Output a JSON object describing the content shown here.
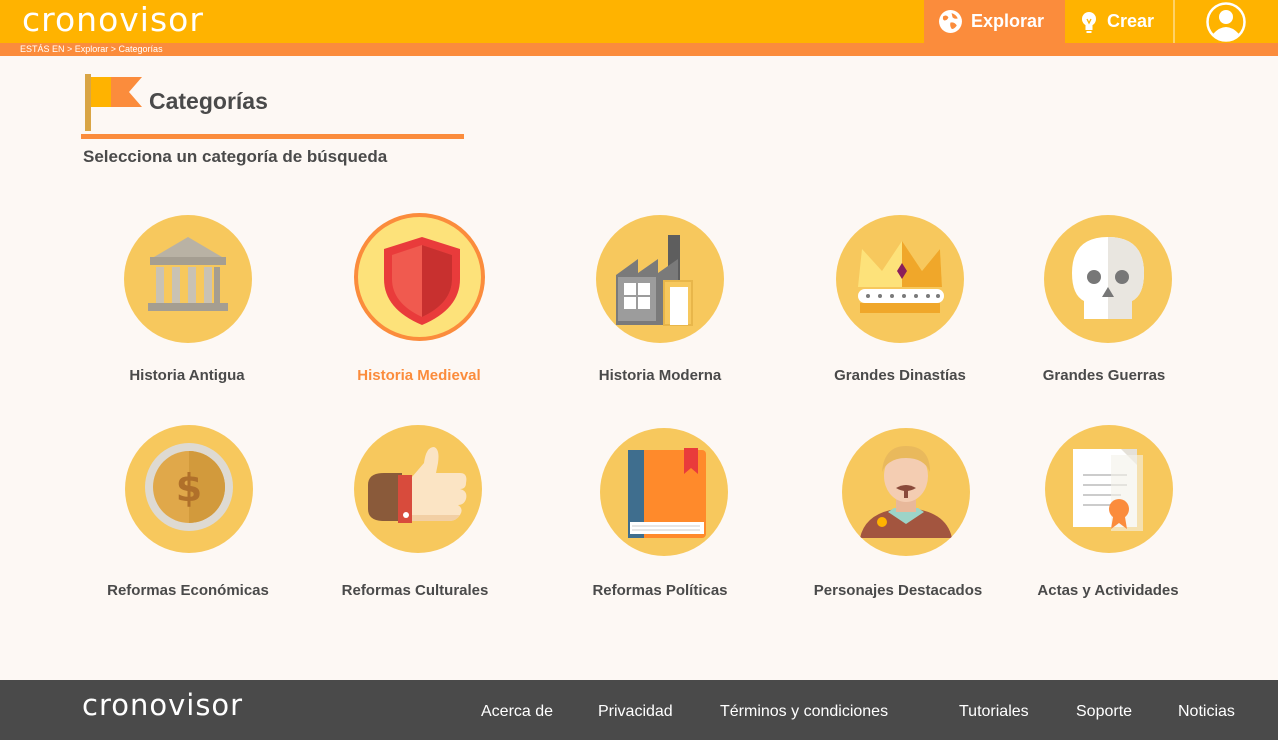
{
  "header": {
    "logo": "cronovisor",
    "nav": [
      {
        "label": "Explorar",
        "icon": "globe-icon"
      },
      {
        "label": "Crear",
        "icon": "lightbulb-icon"
      }
    ],
    "breadcrumb": "ESTÁS EN > Explorar > Categorías"
  },
  "page": {
    "title": "Categorías",
    "subtitle": "Selecciona un categoría de búsqueda"
  },
  "categories": [
    {
      "label": "Historia Antigua",
      "icon": "temple-icon"
    },
    {
      "label": "Historia Medieval",
      "icon": "shield-icon",
      "active": true
    },
    {
      "label": "Historia Moderna",
      "icon": "factory-icon"
    },
    {
      "label": "Grandes Dinastías",
      "icon": "crown-icon"
    },
    {
      "label": "Grandes Guerras",
      "icon": "skull-icon"
    },
    {
      "label": "Reformas Económicas",
      "icon": "coin-icon"
    },
    {
      "label": "Reformas Culturales",
      "icon": "thumbs-up-icon"
    },
    {
      "label": "Reformas Políticas",
      "icon": "book-icon"
    },
    {
      "label": "Personajes Destacados",
      "icon": "person-icon"
    },
    {
      "label": "Actas y Actividades",
      "icon": "certificate-icon"
    }
  ],
  "footer": {
    "logo": "cronovisor",
    "links": [
      "Acerca de",
      "Privacidad",
      "Términos y condiciones",
      "Tutoriales",
      "Soporte",
      "Noticias"
    ]
  },
  "colors": {
    "brand": "#ffb300",
    "accent": "#fb8c3c",
    "footer": "#4a4a4a",
    "circle": "#f7c85d"
  }
}
